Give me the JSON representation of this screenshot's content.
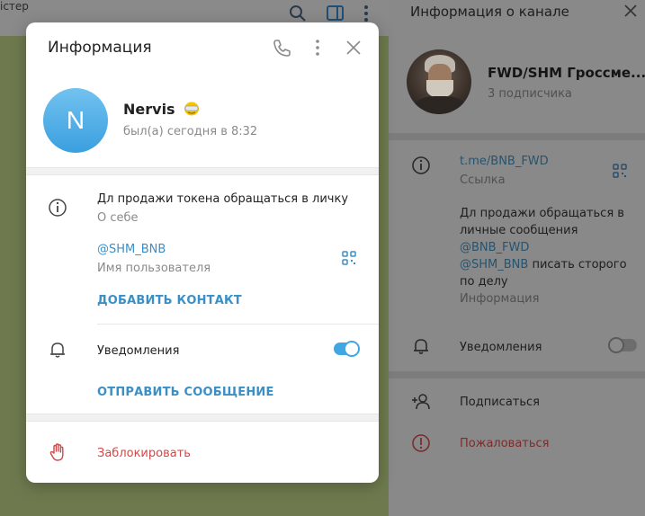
{
  "background": {
    "chat_title_fragment": "істер",
    "icons": [
      "search-icon",
      "sidebar-toggle-icon",
      "more-vertical-icon"
    ]
  },
  "right_panel": {
    "title": "Информация о канале",
    "channel_name": "FWD/SHM Гроссме...",
    "subscribers": "3 подписчика",
    "link": "t.me/BNB_FWD",
    "link_label": "Ссылка",
    "description_line1": "Дл продажи обращаться в",
    "description_line2": "личные сообщения",
    "description_mention1": "@BNB_FWD",
    "description_mention2": "@SHM_BNB",
    "description_tail": " писать сторого",
    "description_line5": "по делу",
    "description_label": "Информация",
    "notifications_label": "Уведомления",
    "subscribe_label": "Подписаться",
    "report_label": "Пожаловаться"
  },
  "modal": {
    "title": "Информация",
    "avatar_letter": "N",
    "user_name": "Nervis",
    "last_seen": "был(а) сегодня в 8:32",
    "bio": "Дл продажи токена обращаться в личку",
    "bio_label": "О себе",
    "username": "@SHM_BNB",
    "username_label": "Имя пользователя",
    "add_contact": "ДОБАВИТЬ КОНТАКТ",
    "notifications_label": "Уведомления",
    "notifications_on": true,
    "send_message": "ОТПРАВИТЬ СООБЩЕНИЕ",
    "block_label": "Заблокировать"
  },
  "colors": {
    "accent": "#3a8fc7",
    "toggle_on": "#40a7e3",
    "danger": "#d14848",
    "avatar_gradient_top": "#72c2f0",
    "avatar_gradient_bottom": "#3a9fde"
  }
}
